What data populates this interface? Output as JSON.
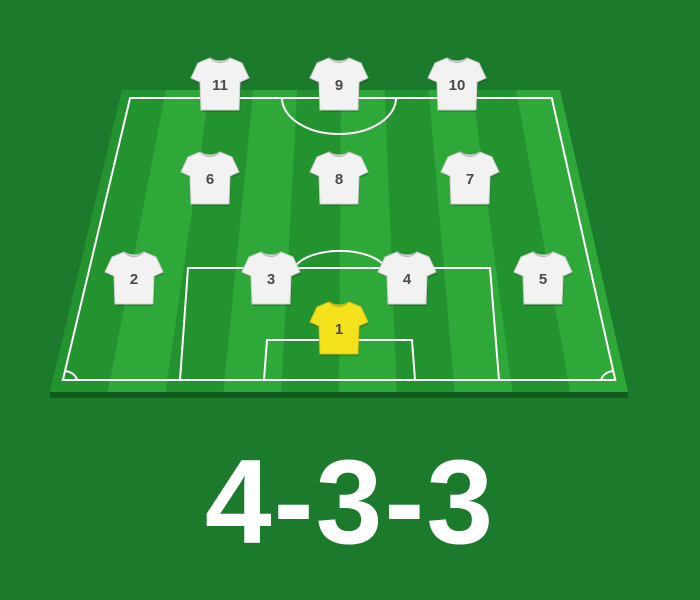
{
  "colors": {
    "background": "#1b7a2c",
    "pitch_light": "#2fa83a",
    "pitch_dark": "#23932f",
    "pitch_edge": "#0f5a1c",
    "lines": "#ffffff",
    "outfield_jersey": "#f2f2f2",
    "goalkeeper_jersey": "#f4e21c",
    "number_text": "#4a4a4a"
  },
  "formation": "4-3-3",
  "players": [
    {
      "number": "1",
      "role": "goalkeeper",
      "jersey": "yellow"
    },
    {
      "number": "2",
      "role": "right-back",
      "jersey": "white"
    },
    {
      "number": "3",
      "role": "center-back",
      "jersey": "white"
    },
    {
      "number": "4",
      "role": "center-back",
      "jersey": "white"
    },
    {
      "number": "5",
      "role": "left-back",
      "jersey": "white"
    },
    {
      "number": "6",
      "role": "midfielder",
      "jersey": "white"
    },
    {
      "number": "8",
      "role": "midfielder",
      "jersey": "white"
    },
    {
      "number": "7",
      "role": "midfielder",
      "jersey": "white"
    },
    {
      "number": "11",
      "role": "forward",
      "jersey": "white"
    },
    {
      "number": "9",
      "role": "forward",
      "jersey": "white"
    },
    {
      "number": "10",
      "role": "forward",
      "jersey": "white"
    }
  ]
}
